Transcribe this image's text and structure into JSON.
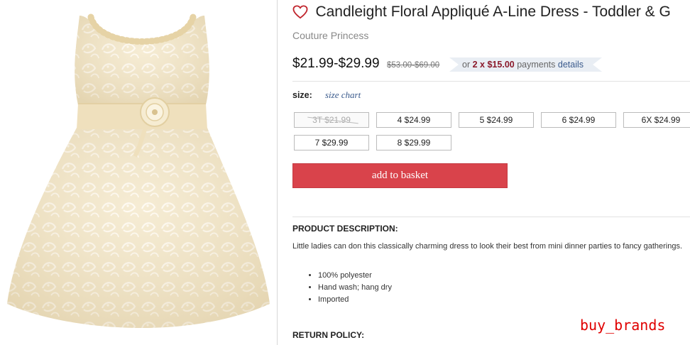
{
  "product": {
    "title": "Candleight Floral Appliqué A-Line Dress - Toddler & G",
    "brand": "Couture Princess",
    "price": "$21.99-$29.99",
    "original_price": "$53.00-$69.00",
    "payment": {
      "prefix": "or",
      "count_label": "2 x",
      "amount": "$15.00",
      "suffix": "payments",
      "details_link": "details"
    },
    "heart_icon": "heart-outline-icon",
    "heart_color": "#c0242c"
  },
  "size": {
    "label": "size:",
    "chart_link": "size chart",
    "options": [
      {
        "label": "3T $21.99",
        "available": false
      },
      {
        "label": "4 $24.99",
        "available": true
      },
      {
        "label": "5 $24.99",
        "available": true
      },
      {
        "label": "6 $24.99",
        "available": true
      },
      {
        "label": "6X $24.99",
        "available": true
      },
      {
        "label": "7 $29.99",
        "available": true
      },
      {
        "label": "8 $29.99",
        "available": true
      }
    ]
  },
  "actions": {
    "add_to_basket": "add to basket",
    "button_color": "#d9434b"
  },
  "description": {
    "heading": "PRODUCT DESCRIPTION:",
    "text": "Little ladies can don this classically charming dress to look their best from mini dinner parties to fancy gatherings.",
    "bullets": [
      "100% polyester",
      "Hand wash; hang dry",
      "Imported"
    ]
  },
  "return_policy": {
    "heading": "RETURN POLICY:"
  },
  "watermark": "buy_brands"
}
